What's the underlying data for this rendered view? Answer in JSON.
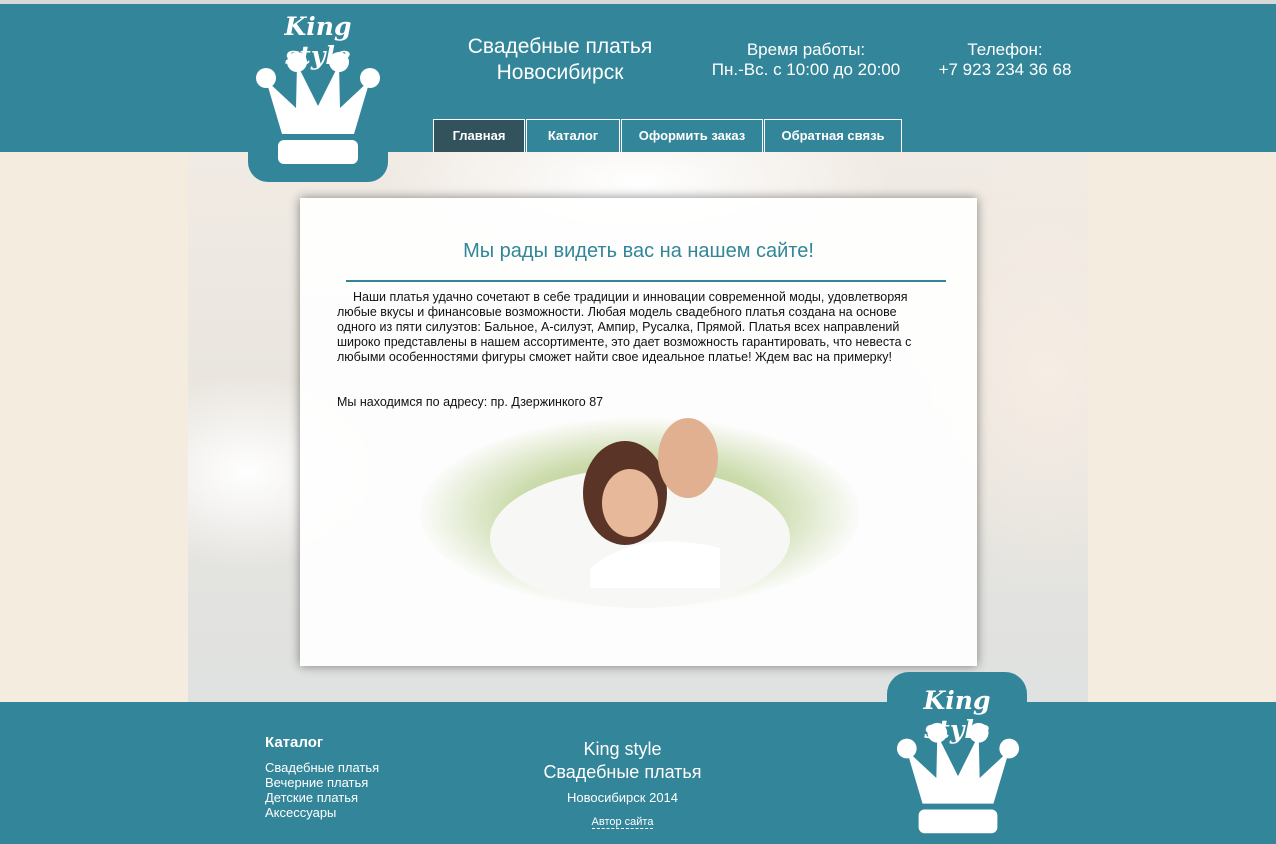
{
  "header": {
    "logo_text": "King style",
    "title_line1": "Свадебные платья",
    "title_line2": "Новосибирск",
    "hours_label": "Время работы:",
    "hours_value": "Пн.-Вс. с 10:00 до 20:00",
    "phone_label": "Телефон:",
    "phone_value": "+7 923 234 36 68"
  },
  "nav": {
    "items": [
      {
        "label": "Главная",
        "active": true
      },
      {
        "label": "Каталог",
        "active": false
      },
      {
        "label": "Оформить заказ",
        "active": false
      },
      {
        "label": "Обратная связь",
        "active": false
      }
    ]
  },
  "main": {
    "heading": "Мы рады видеть вас на нашем сайте!",
    "paragraph": "Наши платья удачно сочетают в себе традиции и инновации современной моды, удовлетворяя любые вкусы и финансовые возможности. Любая модель свадебного платья создана на основе одного из пяти силуэтов: Бальное, А-силуэт, Ампир, Русалка, Прямой. Платья всех направлений широко представлены в нашем ассортименте, это дает возможность гарантировать, что невеста с любыми особенностями фигуры сможет найти свое идеальное платье! Ждем вас на примерку!",
    "address": "Мы находимся по адресу: пр. Дзержинкого 87"
  },
  "footer": {
    "catalog_title": "Каталог",
    "catalog_items": [
      "Свадебные платья",
      "Вечерние платья",
      "Детские платья",
      "Аксессуары"
    ],
    "brand_line1": "King style",
    "brand_line2": "Свадебные платья",
    "city_year": "Новосибирск 2014",
    "author_link": "Автор сайта",
    "logo_text": "King style"
  },
  "colors": {
    "primary": "#338599",
    "nav_active": "#32525c",
    "page_bg": "#f3ecdf"
  },
  "icons": {
    "logo": "crown-icon"
  }
}
